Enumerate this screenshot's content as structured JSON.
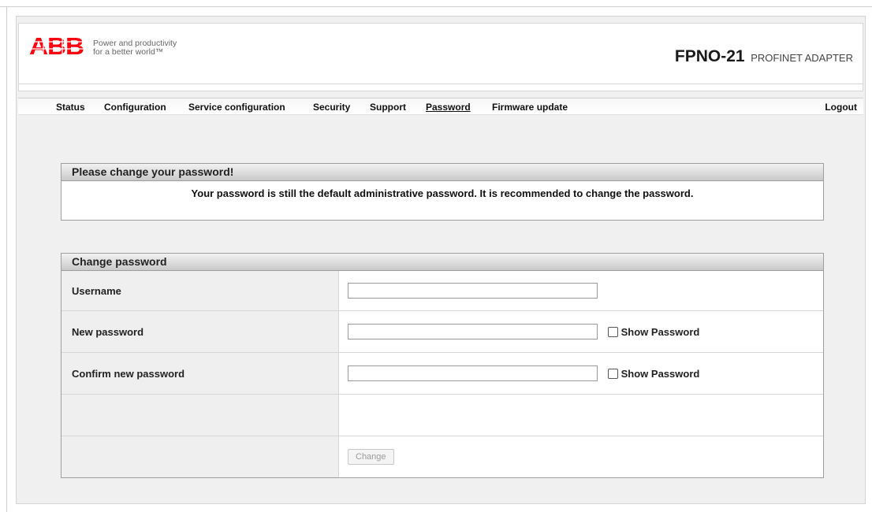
{
  "brand": {
    "logo_text": "ABB",
    "tagline_line1": "Power and productivity",
    "tagline_line2": "for a better world™",
    "model": "FPNO-21",
    "product_type": "PROFINET ADAPTER",
    "logo_color": "#ff000f"
  },
  "nav": {
    "items": [
      {
        "label": "Status"
      },
      {
        "label": "Configuration"
      },
      {
        "label": "Service configuration"
      },
      {
        "label": "Security"
      },
      {
        "label": "Support"
      },
      {
        "label": "Password",
        "active": true
      },
      {
        "label": "Firmware update"
      }
    ],
    "logout": "Logout"
  },
  "notice": {
    "title": "Please change your password!",
    "message": "Your password is still the default administrative password. It is recommended to change the password."
  },
  "change_password": {
    "title": "Change password",
    "rows": [
      {
        "label": "Username",
        "value": "",
        "show_password": false
      },
      {
        "label": "New password",
        "value": "",
        "show_password_label": "Show Password"
      },
      {
        "label": "Confirm new password",
        "value": "",
        "show_password_label": "Show Password"
      }
    ],
    "button": "Change"
  }
}
